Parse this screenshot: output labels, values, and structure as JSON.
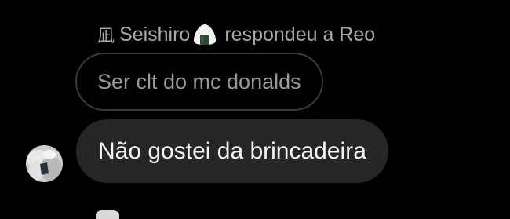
{
  "reply_header": {
    "icon": "reply-chinese-glyph-icon",
    "icon_glyph": "凪",
    "username": "Seishiro",
    "username_emoji": "onigiri-icon",
    "action_text": "respondeu a Reo"
  },
  "quoted_message": {
    "text": "Ser clt do mc donalds"
  },
  "message": {
    "text": "Não gostei da brincadeira"
  },
  "colors": {
    "background": "#000000",
    "bubble": "#262626",
    "quoted_border": "#3a3a3a",
    "muted_text": "#a8a8a8",
    "message_text": "#f5f5f5"
  }
}
